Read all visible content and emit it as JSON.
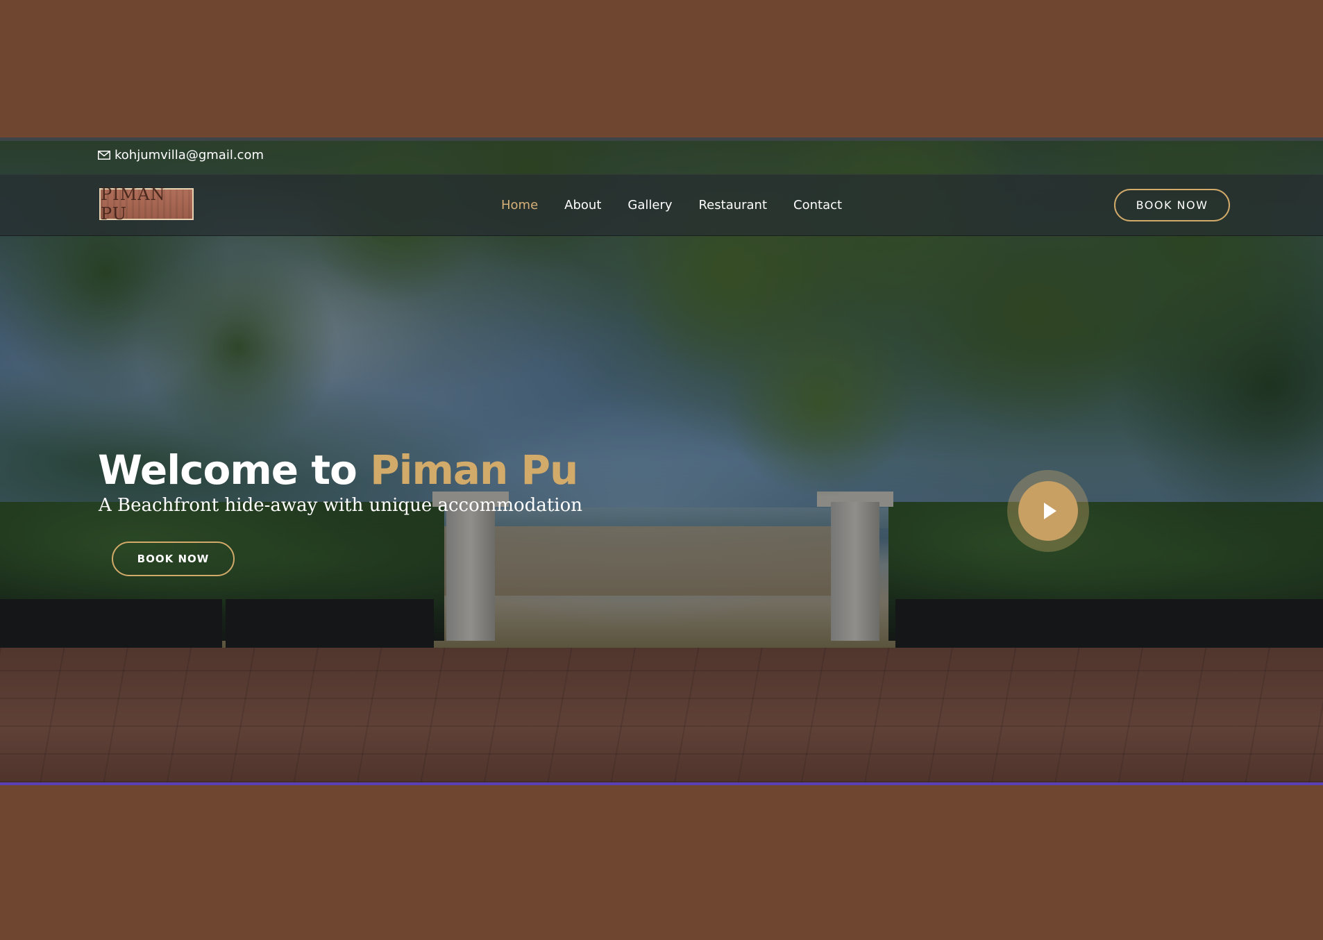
{
  "topbar": {
    "email": "kohjumvilla@gmail.com",
    "email_icon": "envelope-icon"
  },
  "header": {
    "logo_text": "PIMAN PU",
    "nav": [
      {
        "label": "Home",
        "active": true
      },
      {
        "label": "About",
        "active": false
      },
      {
        "label": "Gallery",
        "active": false
      },
      {
        "label": "Restaurant",
        "active": false
      },
      {
        "label": "Contact",
        "active": false
      }
    ],
    "book_label": "BOOK NOW"
  },
  "hero": {
    "title_prefix": "Welcome to ",
    "title_accent": "Piman Pu",
    "subtitle": "A Beachfront hide-away with unique accommodation",
    "book_label": "BOOK NOW",
    "play_icon": "play-icon"
  },
  "colors": {
    "accent": "#d2aa6a",
    "page_background": "#6f4630",
    "header_overlay": "#262c30"
  }
}
